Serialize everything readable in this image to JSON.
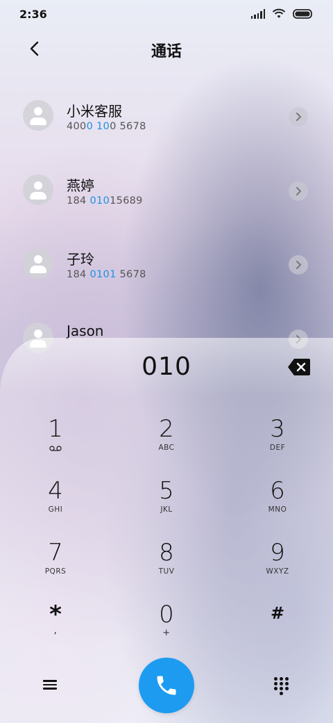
{
  "status_bar": {
    "time": "2:36",
    "icons": [
      "signal-icon",
      "wifi-icon",
      "battery-icon"
    ]
  },
  "header": {
    "title": "通话",
    "back_icon": "back-chevron-icon"
  },
  "contacts": [
    {
      "name": "小米客服",
      "number_parts": [
        {
          "t": "400",
          "hl": false
        },
        {
          "t": "0",
          "hl": true
        },
        {
          "t": " ",
          "hl": false
        },
        {
          "t": "10",
          "hl": true
        },
        {
          "t": "0 5678",
          "hl": false
        }
      ]
    },
    {
      "name": "燕婷",
      "number_parts": [
        {
          "t": "184 ",
          "hl": false
        },
        {
          "t": "010",
          "hl": true
        },
        {
          "t": "15689",
          "hl": false
        }
      ]
    },
    {
      "name": "子玲",
      "number_parts": [
        {
          "t": "184 ",
          "hl": false
        },
        {
          "t": "0101",
          "hl": true
        },
        {
          "t": " 5678",
          "hl": false
        }
      ]
    },
    {
      "name": "Jason",
      "number_parts": []
    }
  ],
  "dialpad": {
    "input": "010",
    "keys": [
      {
        "digit": "1",
        "letters": ""
      },
      {
        "digit": "2",
        "letters": "ABC"
      },
      {
        "digit": "3",
        "letters": "DEF"
      },
      {
        "digit": "4",
        "letters": "GHI"
      },
      {
        "digit": "5",
        "letters": "JKL"
      },
      {
        "digit": "6",
        "letters": "MNO"
      },
      {
        "digit": "7",
        "letters": "PQRS"
      },
      {
        "digit": "8",
        "letters": "TUV"
      },
      {
        "digit": "9",
        "letters": "WXYZ"
      },
      {
        "digit": "*",
        "letters": ","
      },
      {
        "digit": "0",
        "letters": "+"
      },
      {
        "digit": "#",
        "letters": ""
      }
    ]
  },
  "colors": {
    "accent": "#1d9bf0",
    "highlight": "#1e90e6"
  }
}
